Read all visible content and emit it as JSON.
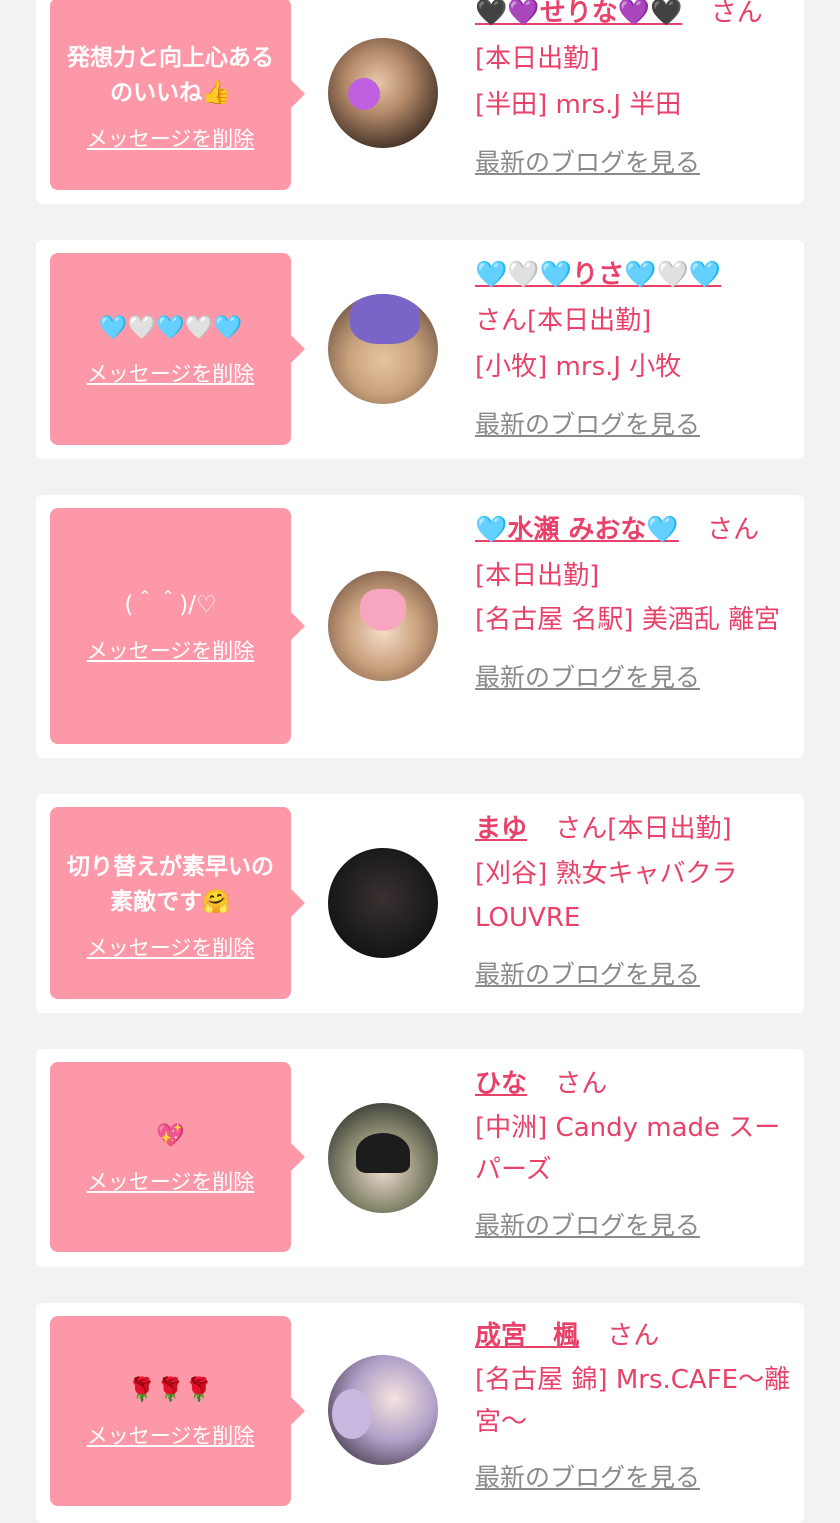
{
  "items": [
    {
      "message": "発想力と向上心あるのいいね👍",
      "delete_label": "メッセージを削除",
      "name": "🖤💜せりな💜🖤",
      "san": "さん",
      "status": "[本日出勤]",
      "shop": "[半田] mrs.J 半田",
      "blog_link": "最新のブログを見る",
      "avatar_colors": [
        "#b48a6a",
        "#3a2a20"
      ]
    },
    {
      "message": "🩵🤍🩵🤍🩵",
      "delete_label": "メッセージを削除",
      "name": "🩵🤍🩵りさ🩵🤍🩵",
      "san": "さん",
      "status": "[本日出勤]",
      "shop": "[小牧] mrs.J 小牧",
      "blog_link": "最新のブログを見る",
      "avatar_colors": [
        "#7b64c8",
        "#c9a27c"
      ]
    },
    {
      "message": "(＾＾)/♡",
      "delete_label": "メッセージを削除",
      "name": "🩵水瀬 みおな🩵",
      "san": "さん",
      "status": "[本日出勤]",
      "shop": "[名古屋 名駅] 美酒乱 離宮",
      "blog_link": "最新のブログを見る",
      "avatar_colors": [
        "#f3b6c8",
        "#a07858"
      ]
    },
    {
      "message": "切り替えが素早いの素敵です🤗",
      "delete_label": "メッセージを削除",
      "name": "まゆ",
      "san": "さん",
      "status": "[本日出勤]",
      "shop": "[刈谷] 熟女キャバクラ LOUVRE",
      "blog_link": "最新のブログを見る",
      "avatar_colors": [
        "#1a1a1a",
        "#3a3030"
      ]
    },
    {
      "message": "💖",
      "delete_label": "メッセージを削除",
      "name": "ひな",
      "san": "さん",
      "status": "",
      "shop": "[中洲] Candy made スーパーズ",
      "blog_link": "最新のブログを見る",
      "avatar_colors": [
        "#8a8a70",
        "#2a2a2a"
      ]
    },
    {
      "message": "🌹🌹🌹",
      "delete_label": "メッセージを削除",
      "name": "成宮　楓",
      "san": "さん",
      "status": "",
      "shop": "[名古屋 錦] Mrs.CAFE～離宮～",
      "blog_link": "最新のブログを見る",
      "avatar_colors": [
        "#b0a0c8",
        "#3a3040"
      ]
    }
  ]
}
